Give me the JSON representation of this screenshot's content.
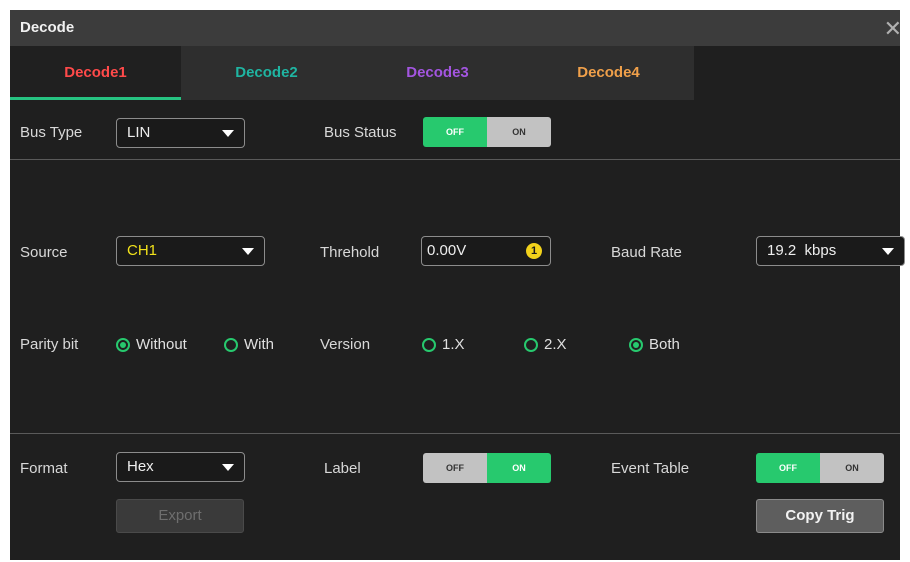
{
  "window": {
    "title": "Decode",
    "close_icon": "close-icon"
  },
  "tabs": [
    {
      "label": "Decode1",
      "color": "#ff4a4a",
      "active": true
    },
    {
      "label": "Decode2",
      "color": "#1fb5a2",
      "active": false
    },
    {
      "label": "Decode3",
      "color": "#a355e0",
      "active": false
    },
    {
      "label": "Decode4",
      "color": "#f0a04a",
      "active": false
    }
  ],
  "bus_type": {
    "label": "Bus Type",
    "value": "LIN"
  },
  "bus_status": {
    "label": "Bus Status",
    "off": "OFF",
    "on": "ON",
    "state": "OFF"
  },
  "source": {
    "label": "Source",
    "value": "CH1",
    "value_color": "#f2e21b"
  },
  "threshold": {
    "label": "Threhold",
    "value": "0.00V",
    "knob_glyph": "1"
  },
  "baud_rate": {
    "label": "Baud Rate",
    "value": "19.2  kbps"
  },
  "parity": {
    "label": "Parity bit",
    "options": [
      "Without",
      "With"
    ],
    "selected": "Without"
  },
  "version": {
    "label": "Version",
    "options": [
      "1.X",
      "2.X",
      "Both"
    ],
    "selected": "Both"
  },
  "format": {
    "label": "Format",
    "value": "Hex"
  },
  "label_toggle": {
    "label": "Label",
    "off": "OFF",
    "on": "ON",
    "state": "ON"
  },
  "event_table": {
    "label": "Event Table",
    "off": "OFF",
    "on": "ON",
    "state": "OFF"
  },
  "buttons": {
    "export": "Export",
    "copy_trig": "Copy Trig"
  },
  "colors": {
    "accent_green": "#27c96e",
    "panel_bg": "#1f1f1f",
    "titlebar_bg": "#3c3c3c"
  }
}
